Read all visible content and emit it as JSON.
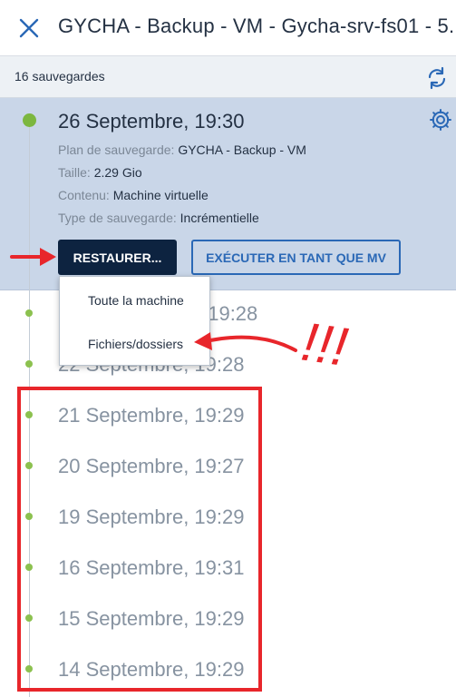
{
  "header": {
    "title": "GYCHA - Backup - VM - Gycha-srv-fs01 - 5..."
  },
  "subbar": {
    "count_label": "16 sauvegardes"
  },
  "selected_backup": {
    "date": "26 Septembre, 19:30",
    "details": [
      {
        "label": "Plan de sauvegarde: ",
        "value": "GYCHA - Backup - VM"
      },
      {
        "label": "Taille: ",
        "value": "2.29 Gio"
      },
      {
        "label": "Contenu: ",
        "value": "Machine virtuelle"
      },
      {
        "label": "Type de sauvegarde: ",
        "value": "Incrémentielle"
      }
    ],
    "restore_label": "RESTAURER...",
    "run_vm_label": "EXÉCUTER EN TANT QUE MV"
  },
  "restore_menu": {
    "items": [
      "Toute la machine",
      "Fichiers/dossiers"
    ]
  },
  "backups": [
    "…, 19:28",
    "22 Septembre, 19:28",
    "21 Septembre, 19:29",
    "20 Septembre, 19:27",
    "19 Septembre, 19:29",
    "16 Septembre, 19:31",
    "15 Septembre, 19:29",
    "14 Septembre, 19:29"
  ],
  "annotation": {
    "text": "!!!",
    "color": "#e8262b"
  },
  "colors": {
    "accent": "#2a68b6",
    "dark_button": "#0d2340",
    "selected_bg": "#c9d6e8",
    "status_green": "#7cb73f"
  },
  "icons": {
    "close": "close-icon",
    "refresh": "refresh-icon",
    "settings": "gear-icon"
  }
}
